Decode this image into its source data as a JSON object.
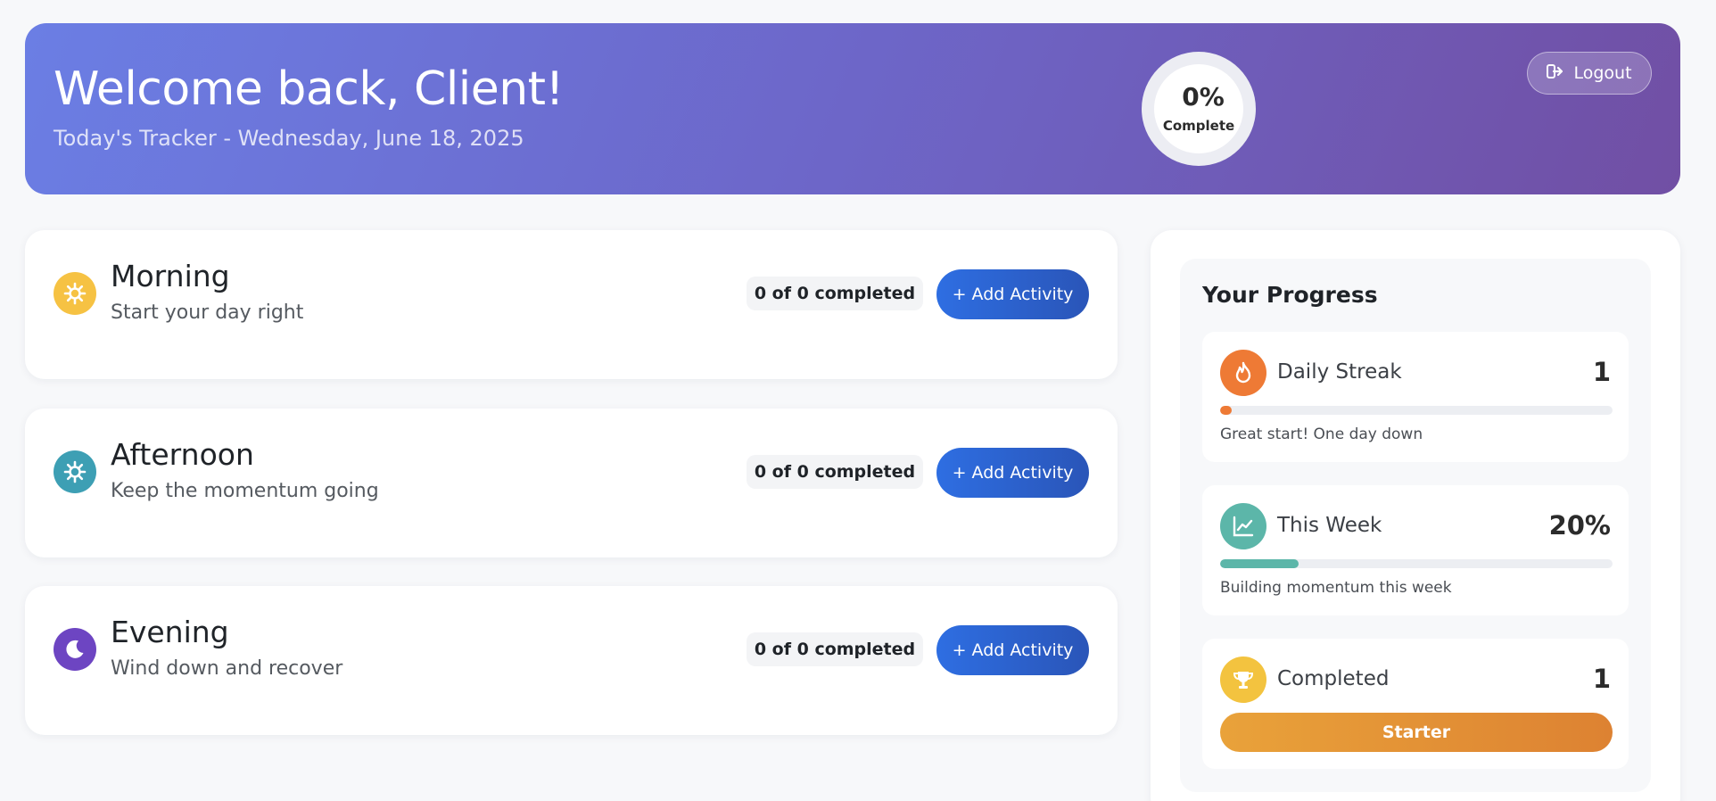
{
  "header": {
    "title": "Welcome back, Client!",
    "subtitle": "Today's Tracker - Wednesday, June 18, 2025",
    "progress": {
      "value_label": "0%",
      "caption": "Complete",
      "percent": 0
    },
    "logout_label": "Logout"
  },
  "sections": [
    {
      "name": "Morning",
      "desc": "Start your day right",
      "count_label": "0 of 0 completed",
      "add_label": "+ Add Activity",
      "icon": "sun-icon",
      "color": "#f6c243"
    },
    {
      "name": "Afternoon",
      "desc": "Keep the momentum going",
      "count_label": "0 of 0 completed",
      "add_label": "+ Add Activity",
      "icon": "sun-icon",
      "color": "#3d9fb4"
    },
    {
      "name": "Evening",
      "desc": "Wind down and recover",
      "count_label": "0 of 0 completed",
      "add_label": "+ Add Activity",
      "icon": "moon-icon",
      "color": "#6d45c2"
    }
  ],
  "progress": {
    "title": "Your Progress",
    "streak": {
      "label": "Daily Streak",
      "value": "1",
      "note": "Great start! One day down",
      "fill_percent": 3,
      "icon": "flame-icon",
      "color": "#ee7a35"
    },
    "week": {
      "label": "This Week",
      "value": "20%",
      "note": "Building momentum this week",
      "fill_percent": 20,
      "icon": "chart-line-icon",
      "color": "#5cb6a9"
    },
    "completed": {
      "label": "Completed",
      "value": "1",
      "badge": "Starter",
      "icon": "trophy-icon",
      "color": "#f3c33f"
    }
  }
}
